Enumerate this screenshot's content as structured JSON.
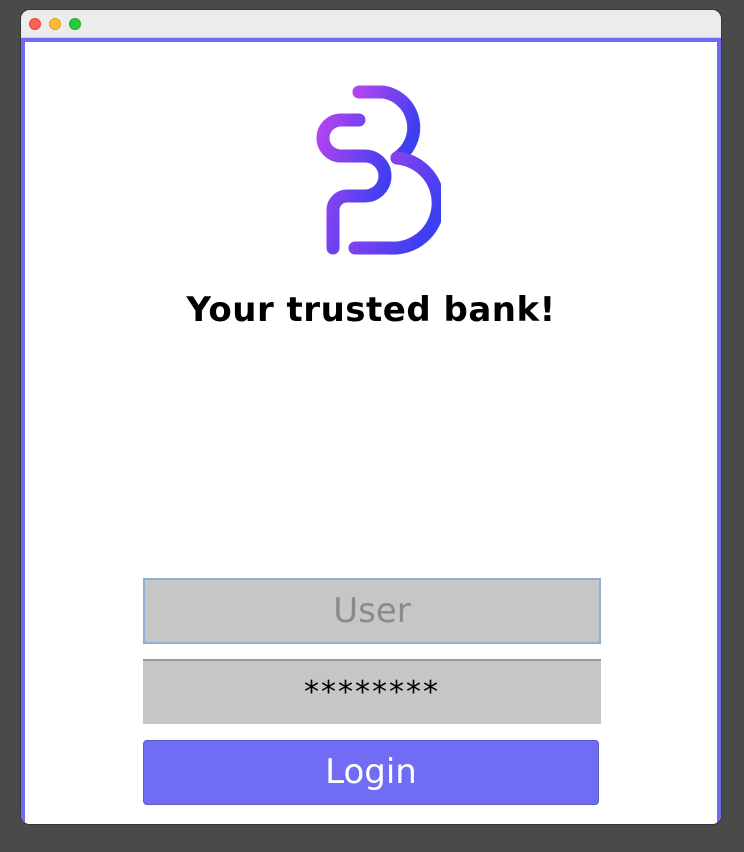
{
  "window": {
    "traffic_lights": [
      "close",
      "minimize",
      "zoom"
    ]
  },
  "logo": {
    "icon": "bank-logo-icon",
    "gradient_start": "#b044f0",
    "gradient_end": "#3b3ff0"
  },
  "tagline": "Your trusted bank!",
  "form": {
    "username": {
      "value": "",
      "placeholder": "User"
    },
    "password": {
      "value": "********"
    },
    "login_label": "Login"
  },
  "colors": {
    "accent": "#706cf4",
    "field_background": "#c6c6c6",
    "frame": "#6e6cf0"
  }
}
